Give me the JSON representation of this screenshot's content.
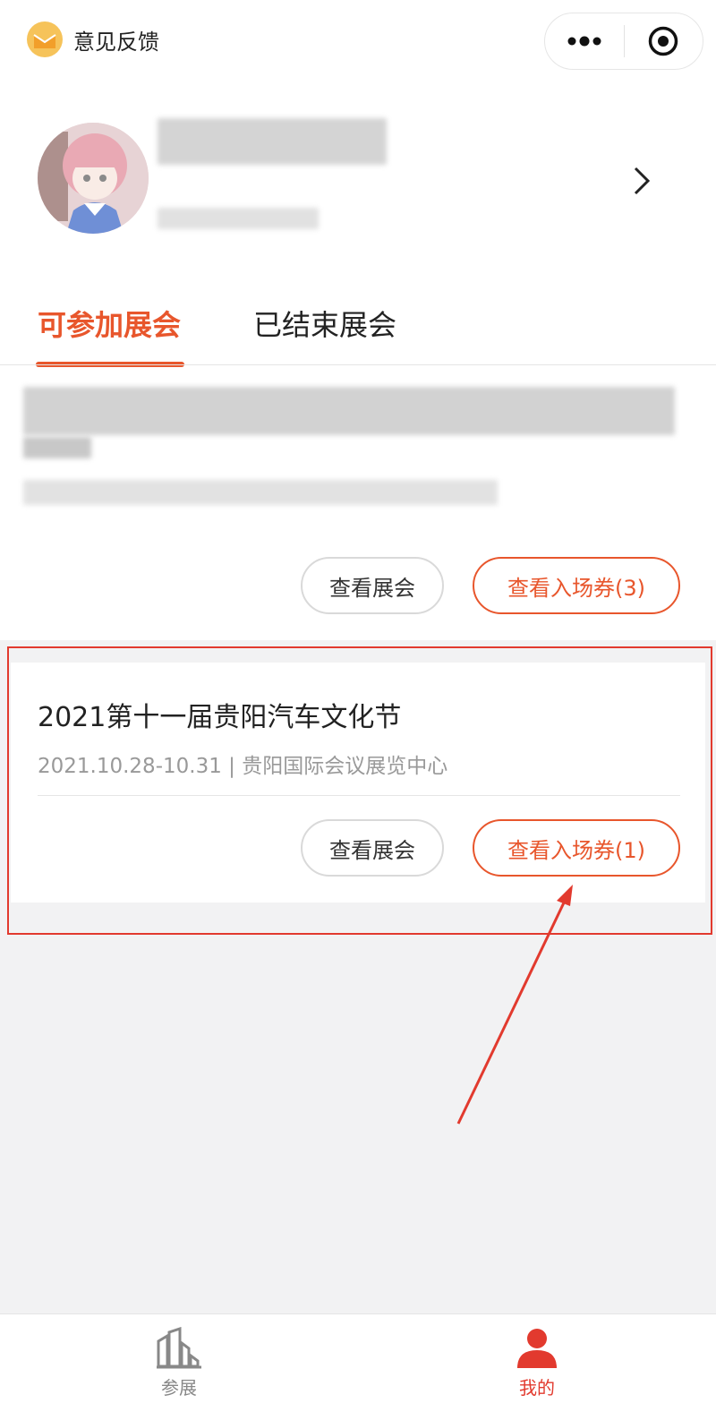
{
  "titlebar": {
    "feedback_label": "意见反馈",
    "more_icon": "more-dots-icon",
    "close_icon": "target-close-icon"
  },
  "profile": {
    "avatar_icon": "user-avatar",
    "arrow_icon": "chevron-right-icon"
  },
  "tabs": [
    {
      "label": "可参加展会",
      "active": true
    },
    {
      "label": "已结束展会",
      "active": false
    }
  ],
  "events": [
    {
      "view_label": "查看展会",
      "tickets_label": "查看入场券(3)"
    },
    {
      "title": "2021第十一届贵阳汽车文化节",
      "meta": "2021.10.28-10.31 | 贵阳国际会议展览中心",
      "view_label": "查看展会",
      "tickets_label": "查看入场券(1)"
    }
  ],
  "bottom_nav": [
    {
      "label": "参展",
      "icon": "buildings-icon",
      "active": false
    },
    {
      "label": "我的",
      "icon": "person-icon",
      "active": true
    }
  ],
  "colors": {
    "accent": "#e8562c",
    "annotation_red": "#e23a2e"
  }
}
